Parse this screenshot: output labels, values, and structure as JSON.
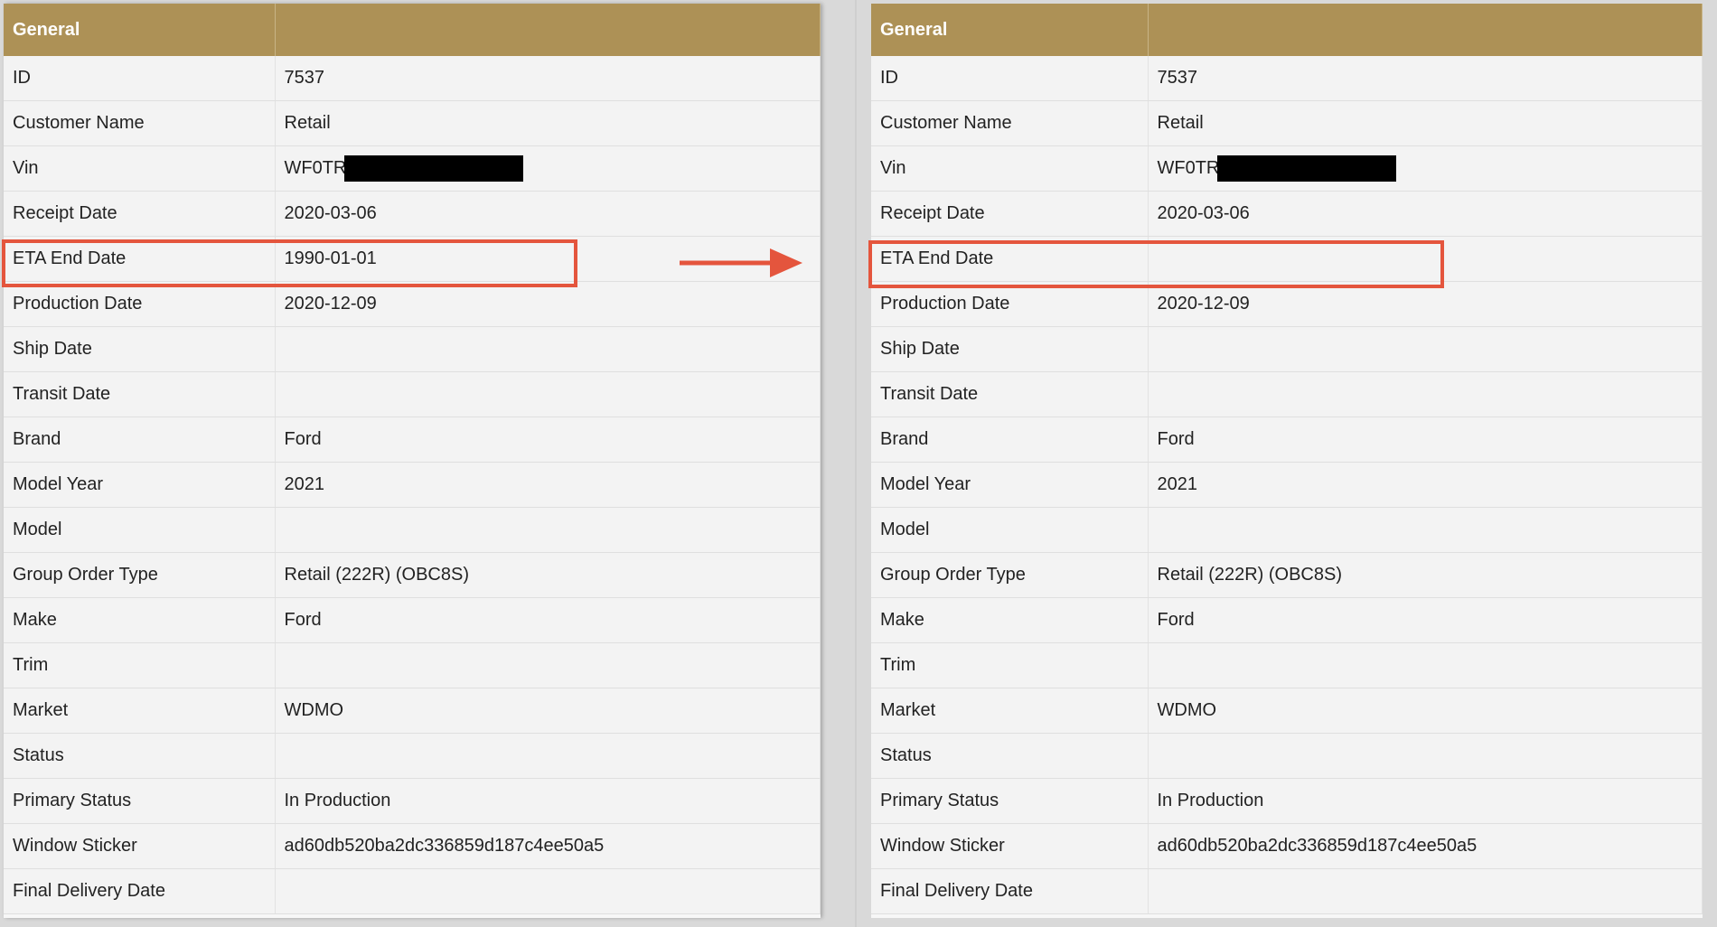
{
  "colors": {
    "header": "#ad9156",
    "highlight": "#e4553d"
  },
  "left_table": {
    "header": "General",
    "rows": [
      {
        "label": "ID",
        "value": "7537"
      },
      {
        "label": "Customer Name",
        "value": "Retail"
      },
      {
        "label": "Vin",
        "value": "WF0TR"
      },
      {
        "label": "Receipt Date",
        "value": "2020-03-06"
      },
      {
        "label": "ETA End Date",
        "value": "1990-01-01"
      },
      {
        "label": "Production Date",
        "value": "2020-12-09"
      },
      {
        "label": "Ship Date",
        "value": ""
      },
      {
        "label": "Transit Date",
        "value": ""
      },
      {
        "label": "Brand",
        "value": "Ford"
      },
      {
        "label": "Model Year",
        "value": "2021"
      },
      {
        "label": "Model",
        "value": ""
      },
      {
        "label": "Group Order Type",
        "value": "Retail (222R) (OBC8S)"
      },
      {
        "label": "Make",
        "value": "Ford"
      },
      {
        "label": "Trim",
        "value": ""
      },
      {
        "label": "Market",
        "value": "WDMO"
      },
      {
        "label": "Status",
        "value": ""
      },
      {
        "label": "Primary Status",
        "value": "In Production"
      },
      {
        "label": "Window Sticker",
        "value": "ad60db520ba2dc336859d187c4ee50a5"
      },
      {
        "label": "Final Delivery Date",
        "value": ""
      }
    ]
  },
  "right_table": {
    "header": "General",
    "rows": [
      {
        "label": "ID",
        "value": "7537"
      },
      {
        "label": "Customer Name",
        "value": "Retail"
      },
      {
        "label": "Vin",
        "value": "WF0TR"
      },
      {
        "label": "Receipt Date",
        "value": "2020-03-06"
      },
      {
        "label": "ETA End Date",
        "value": ""
      },
      {
        "label": "Production Date",
        "value": "2020-12-09"
      },
      {
        "label": "Ship Date",
        "value": ""
      },
      {
        "label": "Transit Date",
        "value": ""
      },
      {
        "label": "Brand",
        "value": "Ford"
      },
      {
        "label": "Model Year",
        "value": "2021"
      },
      {
        "label": "Model",
        "value": ""
      },
      {
        "label": "Group Order Type",
        "value": "Retail (222R) (OBC8S)"
      },
      {
        "label": "Make",
        "value": "Ford"
      },
      {
        "label": "Trim",
        "value": ""
      },
      {
        "label": "Market",
        "value": "WDMO"
      },
      {
        "label": "Status",
        "value": ""
      },
      {
        "label": "Primary Status",
        "value": "In Production"
      },
      {
        "label": "Window Sticker",
        "value": "ad60db520ba2dc336859d187c4ee50a5"
      },
      {
        "label": "Final Delivery Date",
        "value": ""
      }
    ]
  },
  "annotations": {
    "arrow_icon": "right-arrow-icon",
    "redaction": "black-redaction-bar"
  }
}
